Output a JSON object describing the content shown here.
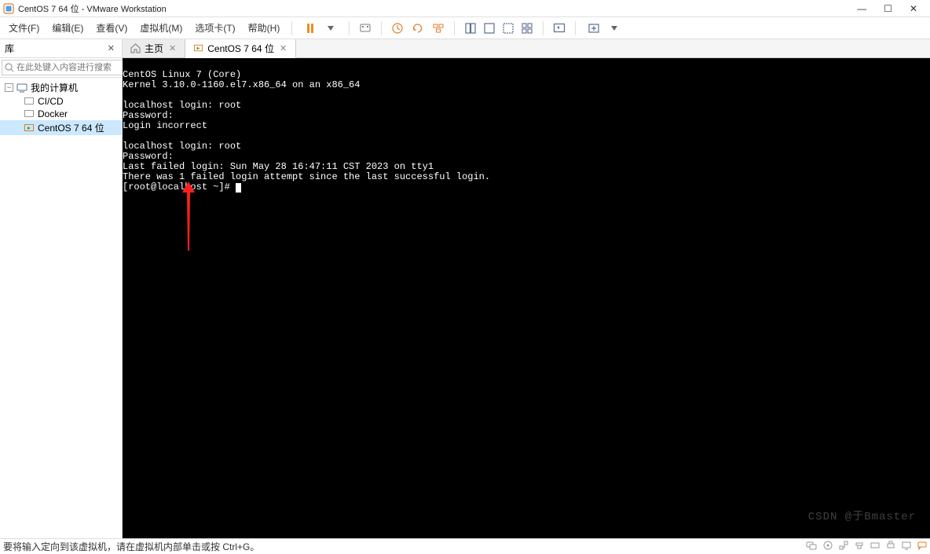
{
  "window": {
    "title": "CentOS 7 64 位 - VMware Workstation"
  },
  "menu": {
    "file": "文件(F)",
    "edit": "编辑(E)",
    "view": "查看(V)",
    "vm": "虚拟机(M)",
    "tabs_menu": "选项卡(T)",
    "help": "帮助(H)"
  },
  "sidebar": {
    "title": "库",
    "search_placeholder": "在此处键入内容进行搜索",
    "tree": {
      "root": "我的计算机",
      "item1": "CI/CD",
      "item2": "Docker",
      "item3": "CentOS 7 64 位"
    }
  },
  "tabs": {
    "home": "主页",
    "active": "CentOS 7 64 位"
  },
  "terminal": {
    "line1": "CentOS Linux 7 (Core)",
    "line2": "Kernel 3.10.0-1160.el7.x86_64 on an x86_64",
    "line3": "",
    "line4": "localhost login: root",
    "line5": "Password:",
    "line6": "Login incorrect",
    "line7": "",
    "line8": "localhost login: root",
    "line9": "Password:",
    "line10": "Last failed login: Sun May 28 16:47:11 CST 2023 on tty1",
    "line11": "There was 1 failed login attempt since the last successful login.",
    "line12": "[root@localhost ~]#"
  },
  "statusbar": {
    "text": "要将输入定向到该虚拟机，请在虚拟机内部单击或按 Ctrl+G。"
  },
  "watermark": "CSDN @于Bmaster"
}
